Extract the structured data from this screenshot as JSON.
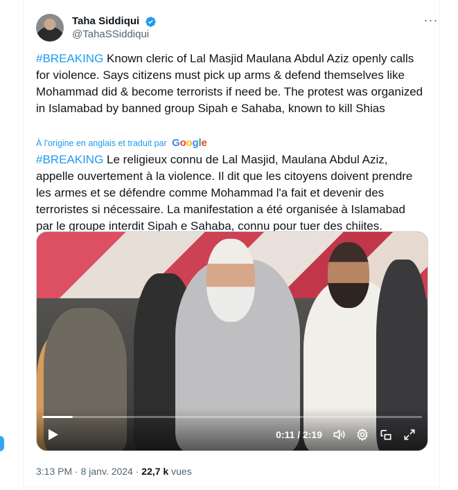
{
  "author": {
    "display_name": "Taha Siddiqui",
    "handle": "@TahaSSiddiqui",
    "verified_color": "#1d9bf0"
  },
  "tweet": {
    "hashtag": "#BREAKING",
    "text": " Known cleric of Lal Masjid Maulana Abdul Aziz openly calls for violence. Says citizens must pick up arms & defend themselves like Mohammad did & become terrorists if need be. The protest was organized in Islamabad by banned group Sipah e Sahaba, known to kill Shias",
    "translation_note": "À l'origine en anglais et traduit par",
    "translation_provider": [
      "G",
      "o",
      "o",
      "g",
      "l",
      "e"
    ],
    "translated_hashtag": "#BREAKING",
    "translated_text": " Le religieux connu de Lal Masjid, Maulana Abdul Aziz, appelle ouvertement à la violence. Il dit que les citoyens doivent prendre les armes et se défendre comme Mohammad l'a fait et devenir des terroristes si nécessaire. La manifestation a été organisée à Islamabad par le groupe interdit Sipah e Sahaba, connu pour tuer des chiites."
  },
  "video": {
    "current_time": "0:11",
    "duration": "2:19",
    "time_display": "0:11 / 2:19",
    "progress_fraction": 0.08
  },
  "meta": {
    "time": "3:13 PM",
    "separator": " · ",
    "date": "8 janv. 2024",
    "views_count": "22,7 k",
    "views_label": " vues"
  },
  "colors": {
    "accent": "#1d9bf0",
    "text": "#0f1419",
    "secondary": "#536471"
  }
}
